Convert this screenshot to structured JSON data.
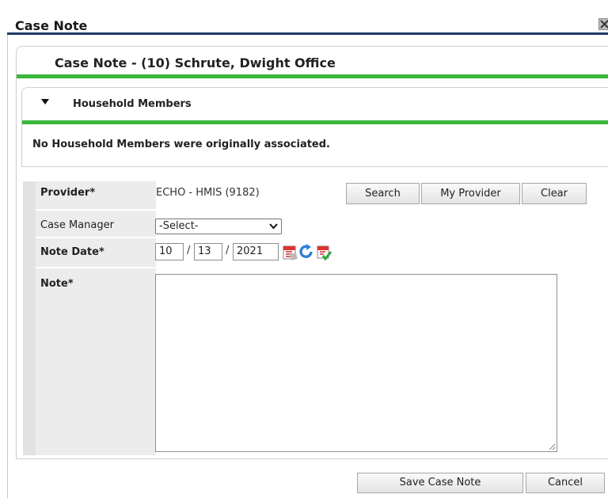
{
  "dialog": {
    "title": "Case Note"
  },
  "panel": {
    "title": "Case Note - (10) Schrute, Dwight Office"
  },
  "household": {
    "title": "Household Members",
    "message": "No Household Members were originally associated."
  },
  "form": {
    "provider_label": "Provider",
    "provider_value": "ECHO - HMIS (9182)",
    "search_label": "Search",
    "my_provider_label": "My Provider",
    "clear_label": "Clear",
    "case_manager_label": "Case Manager",
    "case_manager_selected": "-Select-",
    "note_date_label": "Note Date",
    "date_month": "10",
    "date_day": "13",
    "date_year": "2021",
    "date_separator": "/",
    "note_label": "Note",
    "note_value": "",
    "required_marker": "*"
  },
  "footer": {
    "save_label": "Save Case Note",
    "cancel_label": "Cancel"
  },
  "colors": {
    "title_rule": "#1f3b67",
    "accent_green": "#3cb63c",
    "label_column": "#ececec"
  },
  "icons": {
    "close": "close-icon",
    "collapse": "triangle-down-icon",
    "calendar": "calendar-icon",
    "refresh": "refresh-icon",
    "calendar_check": "calendar-check-icon",
    "dropdown": "chevron-down-icon"
  }
}
